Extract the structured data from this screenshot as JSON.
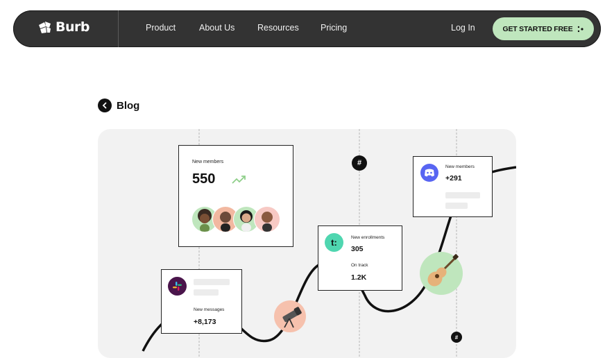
{
  "brand": {
    "name": "Burb"
  },
  "nav": {
    "links": [
      "Product",
      "About Us",
      "Resources",
      "Pricing"
    ],
    "login": "Log In",
    "cta": "GET STARTED FREE"
  },
  "back": {
    "label": "Blog"
  },
  "cards": {
    "members": {
      "label": "New members",
      "value": "550"
    },
    "discord": {
      "label": "New members",
      "value": "+291"
    },
    "enrollments": {
      "label": "New enrollments",
      "value": "305",
      "sub_label": "On track",
      "sub_value": "1.2K",
      "logo_text": "t:"
    },
    "messages": {
      "label": "New messages",
      "value": "+8,173"
    }
  },
  "hash_symbol": "#",
  "colors": {
    "nav_bg": "#333333",
    "cta_bg": "#bfe6bd",
    "hero_bg": "#f2f2f2",
    "discord": "#5865f2",
    "teachable": "#4fd6b0",
    "slack_bg": "#4a154b",
    "growth": "#8fcf8a"
  },
  "icons": [
    "burb-logo-icon",
    "cta-dots-icon",
    "chevron-left-icon",
    "trend-up-icon",
    "discord-icon",
    "slack-icon",
    "teachable-icon",
    "telescope-icon",
    "guitar-icon",
    "hash-icon"
  ]
}
